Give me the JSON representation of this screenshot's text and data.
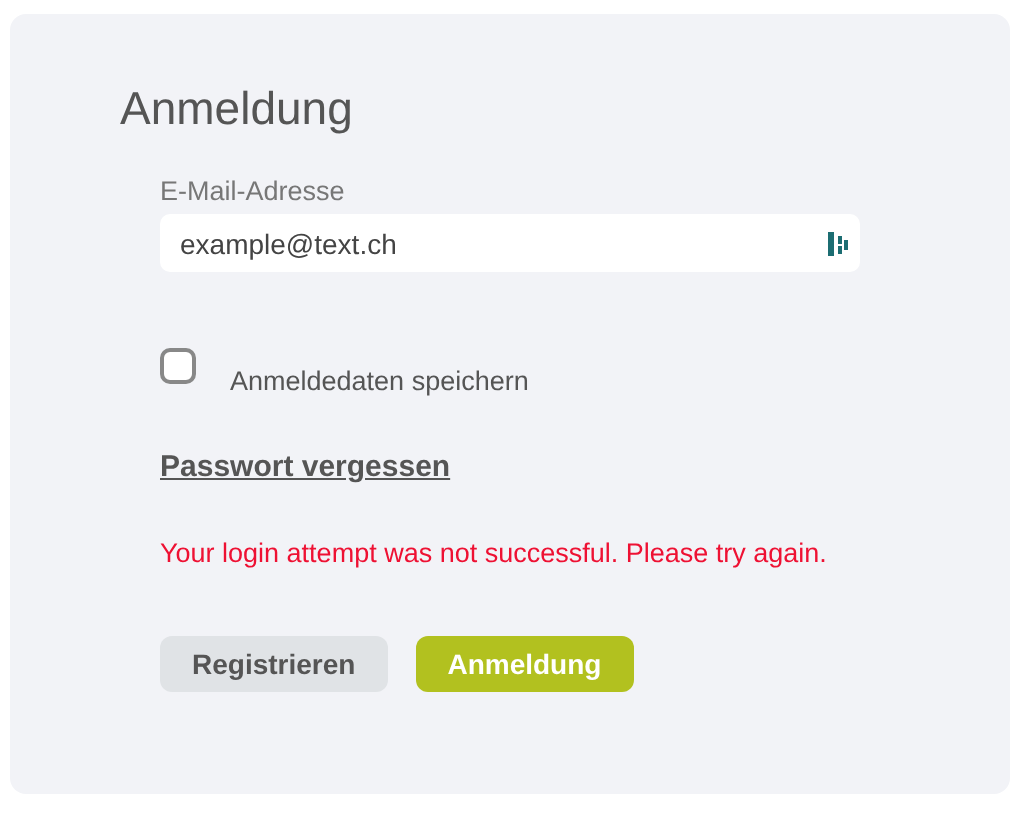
{
  "title": "Anmeldung",
  "email": {
    "label": "E-Mail-Adresse",
    "value": "example@text.ch"
  },
  "remember": {
    "label": "Anmeldedaten speichern",
    "checked": false
  },
  "forgot_link": "Passwort vergessen",
  "error": "Your login attempt was not successful. Please try again.",
  "buttons": [
    {
      "label": "Registrieren",
      "kind": "secondary"
    },
    {
      "label": "Anmeldung",
      "kind": "primary"
    }
  ]
}
